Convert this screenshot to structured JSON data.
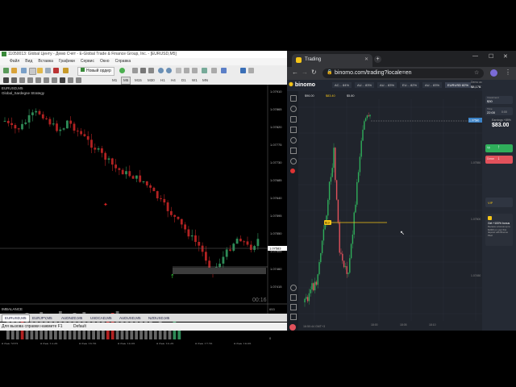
{
  "mt4": {
    "title": "11050013: Global Центу - Демо Счёт - E-Global Trade & Finance Group, Inc. - [EURUSD,M5]",
    "menu": [
      "Файл",
      "Вид",
      "Вставка",
      "Графики",
      "Сервис",
      "Окно",
      "Справка"
    ],
    "new_order": "Новый ордер",
    "timeframes": [
      "M1",
      "M5",
      "M15",
      "M30",
      "H1",
      "H4",
      "D1",
      "W1",
      "MN"
    ],
    "active_timeframe": "M5",
    "chart": {
      "symbol_label": "EURUSD,M5",
      "strategy_label": "Global_Sardegne Strategy",
      "countdown": "00:16",
      "price_labels": [
        "1.07910",
        "1.07865",
        "1.07820",
        "1.07775",
        "1.07730",
        "1.07685",
        "1.07640",
        "1.07595",
        "1.07550",
        "1.07505",
        "1.07460",
        "1.07415"
      ],
      "current_price": "1.07583",
      "indicator_label": "IMBALANCE",
      "indicator_axis_top": "653",
      "indicator_axis_bottom": "0",
      "time_labels": [
        "9 Feb 2023",
        "9 Feb 14:45",
        "9 Feb 15:25",
        "9 Feb 16:05",
        "9 Feb 16:45",
        "9 Feb 17:25",
        "9 Feb 18:05"
      ],
      "colors": {
        "bull": "#2e8b57",
        "bear": "#b22222",
        "grey": "#666666",
        "bg": "#000000"
      }
    },
    "tabs": [
      "EURUSD,M5",
      "EURJPY,M5",
      "AUDNZD,M5",
      "USDCAD,M5",
      "AUDUSD,M5",
      "NZDUSD,M5"
    ],
    "active_tab": "EURUSD,M5",
    "status_help": "Для вызова справки нажмите F1",
    "status_profile": "Default"
  },
  "browser": {
    "tab_title": "Trading",
    "url": "binomo.com/trading?locale=en",
    "site": {
      "logo": "binomo",
      "assets": [
        "AC... 84%",
        "AU... 83%",
        "AU... 83%",
        "EU... 82%",
        "AU... 83%",
        "EURUSD 82%"
      ],
      "balance_label": "Demo account",
      "balance": "$8,178.70",
      "deposit": "Deposit",
      "legend": [
        "$96.00",
        "$83.40",
        "$5.80"
      ],
      "price_tag": "1.07580",
      "entry_tag": "$13",
      "right_axis": [
        "1.07550",
        "1.07500",
        "1.07450"
      ],
      "bottom_clock": "16:50:44 GMT+3",
      "time_labels": [
        "18:00",
        "18:05",
        "18:10"
      ],
      "timer_label": "Time",
      "timer_value": "0:00",
      "time_value": "22:00",
      "investment_label": "Investment",
      "investment_value": "$30",
      "payout_label": "Earnings +89%",
      "payout_value": "$83.00",
      "up_label": "Up",
      "down_label": "Down",
      "vip_label": "VIP",
      "promo_title": "Get +100% bonus",
      "promo_text": "Receive a bonus up to $1000 on your first deposit with Binomo Plus!",
      "colors": {
        "bg": "#20242c",
        "up": "#2fae5a",
        "down": "#e2515b",
        "accent": "#f5c518"
      }
    }
  }
}
